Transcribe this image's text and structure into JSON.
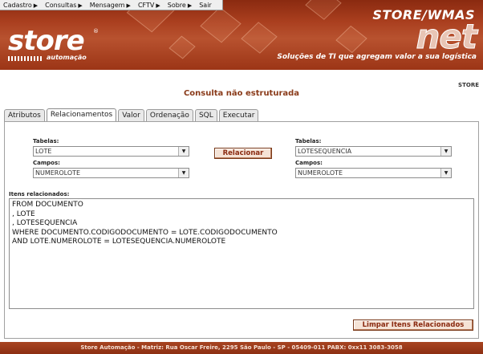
{
  "menu": {
    "items": [
      {
        "label": "Cadastro",
        "has_submenu": true
      },
      {
        "label": "Consultas",
        "has_submenu": true
      },
      {
        "label": "Mensagem",
        "has_submenu": true
      },
      {
        "label": "CFTV",
        "has_submenu": true
      },
      {
        "label": "Sobre",
        "has_submenu": true
      },
      {
        "label": "Sair",
        "has_submenu": false
      }
    ],
    "submenu_glyph": "▶"
  },
  "header": {
    "logo_text": "store",
    "logo_reg": "®",
    "logo_subtext": "automação",
    "product_name": "STORE/WMAS",
    "product_suffix": "net",
    "tagline": "Soluções de TI que agregam valor a sua logística"
  },
  "store_label": "STORE",
  "page_title": "Consulta não estruturada",
  "tabs": [
    {
      "label": "Atributos",
      "active": false
    },
    {
      "label": "Relacionamentos",
      "active": true
    },
    {
      "label": "Valor",
      "active": false
    },
    {
      "label": "Ordenação",
      "active": false
    },
    {
      "label": "SQL",
      "active": false
    },
    {
      "label": "Executar",
      "active": false
    }
  ],
  "relacionamentos": {
    "left": {
      "tabelas_label": "Tabelas:",
      "tabelas_value": "LOTE",
      "campos_label": "Campos:",
      "campos_value": "NUMEROLOTE"
    },
    "right": {
      "tabelas_label": "Tabelas:",
      "tabelas_value": "LOTESEQUENCIA",
      "campos_label": "Campos:",
      "campos_value": "NUMEROLOTE"
    },
    "relacionar_label": "Relacionar",
    "itens_label": "Itens relacionados:",
    "itens_text": "FROM DOCUMENTO\n, LOTE\n, LOTESEQUENCIA\nWHERE DOCUMENTO.CODIGODOCUMENTO = LOTE.CODIGODOCUMENTO\nAND LOTE.NUMEROLOTE = LOTESEQUENCIA.NUMEROLOTE",
    "limpar_label": "Limpar Itens Relacionados"
  },
  "footer_text": "Store Automação - Matriz: Rua Oscar Freire, 2295 São Paulo - SP - 05409-011 PABX: 0xx11 3083-3058",
  "colors": {
    "brand": "#a93e1e",
    "title_text": "#8a3b1a",
    "button_bg": "#f5e3d6"
  }
}
